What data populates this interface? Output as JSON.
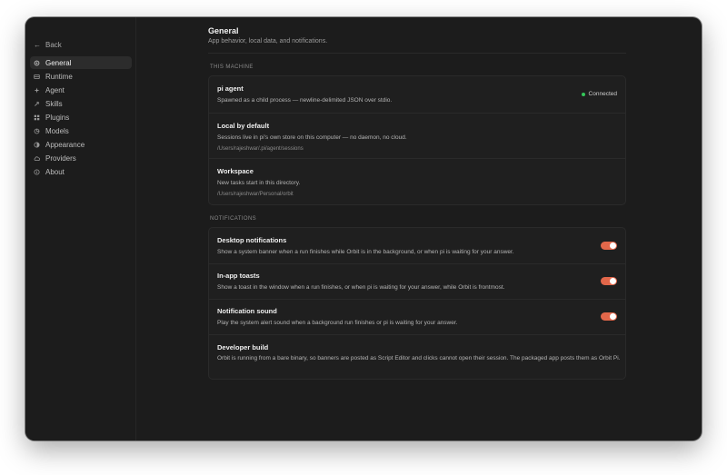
{
  "sidebar": {
    "back_label": "Back",
    "items": [
      {
        "label": "General",
        "icon": "gear-icon",
        "active": true
      },
      {
        "label": "Runtime",
        "icon": "runtime-icon",
        "active": false
      },
      {
        "label": "Agent",
        "icon": "agent-icon",
        "active": false
      },
      {
        "label": "Skills",
        "icon": "skills-icon",
        "active": false
      },
      {
        "label": "Plugins",
        "icon": "plugins-icon",
        "active": false
      },
      {
        "label": "Models",
        "icon": "models-icon",
        "active": false
      },
      {
        "label": "Appearance",
        "icon": "appearance-icon",
        "active": false
      },
      {
        "label": "Providers",
        "icon": "providers-icon",
        "active": false
      },
      {
        "label": "About",
        "icon": "info-icon",
        "active": false
      }
    ]
  },
  "header": {
    "title": "General",
    "subtitle": "App behavior, local data, and notifications."
  },
  "this_machine": {
    "label": "THIS MACHINE",
    "rows": [
      {
        "title": "pi agent",
        "description": "Spawned as a child process — newline-delimited JSON over stdio.",
        "status": "Connected"
      },
      {
        "title": "Local by default",
        "description": "Sessions live in pi's own store on this computer — no daemon, no cloud.",
        "path": "/Users/rajeshwar/.pi/agent/sessions"
      },
      {
        "title": "Workspace",
        "description": "New tasks start in this directory.",
        "path": "/Users/rajeshwar/Personal/orbit"
      }
    ]
  },
  "notifications": {
    "label": "NOTIFICATIONS",
    "rows": [
      {
        "title": "Desktop notifications",
        "description": "Show a system banner when a run finishes while Orbit is in the background, or when pi is waiting for your answer.",
        "enabled": true
      },
      {
        "title": "In-app toasts",
        "description": "Show a toast in the window when a run finishes, or when pi is waiting for your answer, while Orbit is frontmost.",
        "enabled": true
      },
      {
        "title": "Notification sound",
        "description": "Play the system alert sound when a background run finishes or pi is waiting for your answer.",
        "enabled": true
      },
      {
        "title": "Developer build",
        "description": "Orbit is running from a bare binary, so banners are posted as Script Editor and clicks cannot open their session. The packaged app posts them as Orbit Pi."
      }
    ]
  },
  "colors": {
    "accent": "#e2674a",
    "status_ok": "#34c759",
    "window_bg": "#1c1c1c"
  }
}
